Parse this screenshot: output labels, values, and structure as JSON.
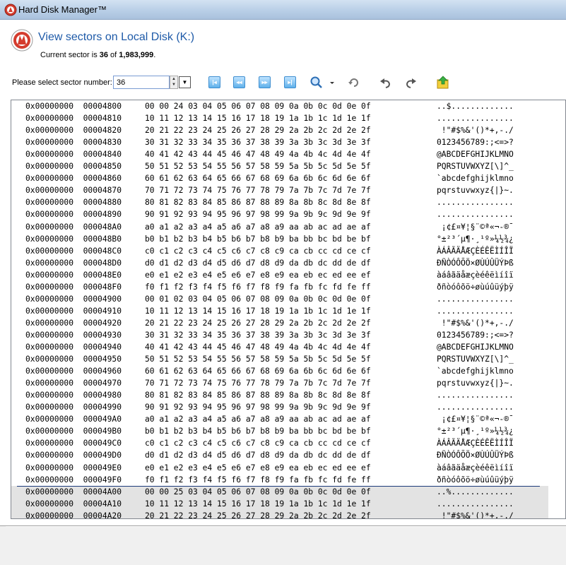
{
  "window": {
    "title": "Hard Disk Manager™"
  },
  "header": {
    "title": "View sectors on Local Disk (K:)",
    "current_prefix": "Current sector is ",
    "current_sector": "36",
    "current_mid": " of ",
    "total_sectors": "1,983,999",
    "current_suffix": "."
  },
  "toolbar": {
    "sector_label": "Please select sector number:",
    "sector_value": "36",
    "buttons": [
      "first-sector",
      "previous-sector",
      "next-sector",
      "last-sector",
      "search",
      "reload",
      "undo",
      "redo",
      "save"
    ]
  },
  "hex_rows": [
    {
      "addr": "0x00000000  00004800",
      "bytes": "00 00 24 03 04 05 06 07 08 09 0a 0b 0c 0d 0e 0f",
      "ascii": "..$............."
    },
    {
      "addr": "0x00000000  00004810",
      "bytes": "10 11 12 13 14 15 16 17 18 19 1a 1b 1c 1d 1e 1f",
      "ascii": "................"
    },
    {
      "addr": "0x00000000  00004820",
      "bytes": "20 21 22 23 24 25 26 27 28 29 2a 2b 2c 2d 2e 2f",
      "ascii": " !\"#$%&'()*+,-./"
    },
    {
      "addr": "0x00000000  00004830",
      "bytes": "30 31 32 33 34 35 36 37 38 39 3a 3b 3c 3d 3e 3f",
      "ascii": "0123456789:;<=>?"
    },
    {
      "addr": "0x00000000  00004840",
      "bytes": "40 41 42 43 44 45 46 47 48 49 4a 4b 4c 4d 4e 4f",
      "ascii": "@ABCDEFGHIJKLMNO"
    },
    {
      "addr": "0x00000000  00004850",
      "bytes": "50 51 52 53 54 55 56 57 58 59 5a 5b 5c 5d 5e 5f",
      "ascii": "PQRSTUVWXYZ[\\]^_"
    },
    {
      "addr": "0x00000000  00004860",
      "bytes": "60 61 62 63 64 65 66 67 68 69 6a 6b 6c 6d 6e 6f",
      "ascii": "`abcdefghijklmno"
    },
    {
      "addr": "0x00000000  00004870",
      "bytes": "70 71 72 73 74 75 76 77 78 79 7a 7b 7c 7d 7e 7f",
      "ascii": "pqrstuvwxyz{|}~."
    },
    {
      "addr": "0x00000000  00004880",
      "bytes": "80 81 82 83 84 85 86 87 88 89 8a 8b 8c 8d 8e 8f",
      "ascii": "................"
    },
    {
      "addr": "0x00000000  00004890",
      "bytes": "90 91 92 93 94 95 96 97 98 99 9a 9b 9c 9d 9e 9f",
      "ascii": "................"
    },
    {
      "addr": "0x00000000  000048A0",
      "bytes": "a0 a1 a2 a3 a4 a5 a6 a7 a8 a9 aa ab ac ad ae af",
      "ascii": " ¡¢£¤¥¦§¨©ª«¬-®¯"
    },
    {
      "addr": "0x00000000  000048B0",
      "bytes": "b0 b1 b2 b3 b4 b5 b6 b7 b8 b9 ba bb bc bd be bf",
      "ascii": "°±²³´µ¶·¸¹º»¼½¾¿"
    },
    {
      "addr": "0x00000000  000048C0",
      "bytes": "c0 c1 c2 c3 c4 c5 c6 c7 c8 c9 ca cb cc cd ce cf",
      "ascii": "ÀÁÂÃÄÅÆÇÈÉÊËÌÍÎÏ"
    },
    {
      "addr": "0x00000000  000048D0",
      "bytes": "d0 d1 d2 d3 d4 d5 d6 d7 d8 d9 da db dc dd de df",
      "ascii": "ÐÑÒÓÔÕÖ×ØÙÚÛÜÝÞß"
    },
    {
      "addr": "0x00000000  000048E0",
      "bytes": "e0 e1 e2 e3 e4 e5 e6 e7 e8 e9 ea eb ec ed ee ef",
      "ascii": "àáâãäåæçèéêëìíîï"
    },
    {
      "addr": "0x00000000  000048F0",
      "bytes": "f0 f1 f2 f3 f4 f5 f6 f7 f8 f9 fa fb fc fd fe ff",
      "ascii": "ðñòóôõö÷øùúûüýþÿ"
    },
    {
      "addr": "0x00000000  00004900",
      "bytes": "00 01 02 03 04 05 06 07 08 09 0a 0b 0c 0d 0e 0f",
      "ascii": "................"
    },
    {
      "addr": "0x00000000  00004910",
      "bytes": "10 11 12 13 14 15 16 17 18 19 1a 1b 1c 1d 1e 1f",
      "ascii": "................"
    },
    {
      "addr": "0x00000000  00004920",
      "bytes": "20 21 22 23 24 25 26 27 28 29 2a 2b 2c 2d 2e 2f",
      "ascii": " !\"#$%&'()*+,-./"
    },
    {
      "addr": "0x00000000  00004930",
      "bytes": "30 31 32 33 34 35 36 37 38 39 3a 3b 3c 3d 3e 3f",
      "ascii": "0123456789:;<=>?"
    },
    {
      "addr": "0x00000000  00004940",
      "bytes": "40 41 42 43 44 45 46 47 48 49 4a 4b 4c 4d 4e 4f",
      "ascii": "@ABCDEFGHIJKLMNO"
    },
    {
      "addr": "0x00000000  00004950",
      "bytes": "50 51 52 53 54 55 56 57 58 59 5a 5b 5c 5d 5e 5f",
      "ascii": "PQRSTUVWXYZ[\\]^_"
    },
    {
      "addr": "0x00000000  00004960",
      "bytes": "60 61 62 63 64 65 66 67 68 69 6a 6b 6c 6d 6e 6f",
      "ascii": "`abcdefghijklmno"
    },
    {
      "addr": "0x00000000  00004970",
      "bytes": "70 71 72 73 74 75 76 77 78 79 7a 7b 7c 7d 7e 7f",
      "ascii": "pqrstuvwxyz{|}~."
    },
    {
      "addr": "0x00000000  00004980",
      "bytes": "80 81 82 83 84 85 86 87 88 89 8a 8b 8c 8d 8e 8f",
      "ascii": "................"
    },
    {
      "addr": "0x00000000  00004990",
      "bytes": "90 91 92 93 94 95 96 97 98 99 9a 9b 9c 9d 9e 9f",
      "ascii": "................"
    },
    {
      "addr": "0x00000000  000049A0",
      "bytes": "a0 a1 a2 a3 a4 a5 a6 a7 a8 a9 aa ab ac ad ae af",
      "ascii": " ¡¢£¤¥¦§¨©ª«¬-®¯"
    },
    {
      "addr": "0x00000000  000049B0",
      "bytes": "b0 b1 b2 b3 b4 b5 b6 b7 b8 b9 ba bb bc bd be bf",
      "ascii": "°±²³´µ¶·¸¹º»¼½¾¿"
    },
    {
      "addr": "0x00000000  000049C0",
      "bytes": "c0 c1 c2 c3 c4 c5 c6 c7 c8 c9 ca cb cc cd ce cf",
      "ascii": "ÀÁÂÃÄÅÆÇÈÉÊËÌÍÎÏ"
    },
    {
      "addr": "0x00000000  000049D0",
      "bytes": "d0 d1 d2 d3 d4 d5 d6 d7 d8 d9 da db dc dd de df",
      "ascii": "ÐÑÒÓÔÕÖ×ØÙÚÛÜÝÞß"
    },
    {
      "addr": "0x00000000  000049E0",
      "bytes": "e0 e1 e2 e3 e4 e5 e6 e7 e8 e9 ea eb ec ed ee ef",
      "ascii": "àáâãäåæçèéêëìíîï"
    },
    {
      "addr": "0x00000000  000049F0",
      "bytes": "f0 f1 f2 f3 f4 f5 f6 f7 f8 f9 fa fb fc fd fe ff",
      "ascii": "ðñòóôõö÷øùúûüýþÿ"
    },
    {
      "addr": "0x00000000  00004A00",
      "bytes": "00 00 25 03 04 05 06 07 08 09 0a 0b 0c 0d 0e 0f",
      "ascii": "..%............."
    },
    {
      "addr": "0x00000000  00004A10",
      "bytes": "10 11 12 13 14 15 16 17 18 19 1a 1b 1c 1d 1e 1f",
      "ascii": "................"
    },
    {
      "addr": "0x00000000  00004A20",
      "bytes": "20 21 22 23 24 25 26 27 28 29 2a 2b 2c 2d 2e 2f",
      "ascii": " !\"#$%&'()*+,-./"
    }
  ],
  "selected_from_row": 32,
  "colors": {
    "title_blue": "#1e5aa8",
    "selection_gray": "#e3e3e3",
    "accent_blue": "#3e8ed0"
  }
}
